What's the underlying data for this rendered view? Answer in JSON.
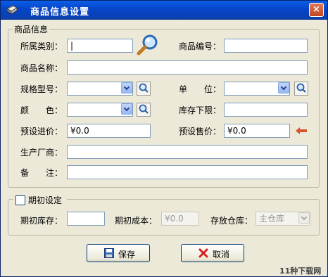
{
  "window": {
    "title": "商品信息设置",
    "close_symbol": "×",
    "icon": "app-book-icon"
  },
  "product_group": {
    "legend": "商品信息",
    "category_label": "所属类别：",
    "category_value": "|",
    "code_label": "商品编号：",
    "code_value": "",
    "name_label": "商品名称：",
    "name_value": "",
    "spec_label": "规格型号：",
    "spec_value": "",
    "unit_label": "单　　位：",
    "unit_value": "",
    "color_label": "颜　　色：",
    "color_value": "",
    "stock_min_label": "库存下限：",
    "stock_min_value": "",
    "preset_buy_label": "预设进价：",
    "preset_buy_value": "¥0.0",
    "preset_sell_label": "预设售价：",
    "preset_sell_value": "¥0.0",
    "manufacturer_label": "生产厂商：",
    "manufacturer_value": "",
    "remark_label": "备　　注：",
    "remark_value": ""
  },
  "opening_group": {
    "legend": "期初设定",
    "checked": false,
    "opening_stock_label": "期初库存：",
    "opening_stock_value": "",
    "opening_cost_label": "期初成本：",
    "opening_cost_value": "¥0.0",
    "warehouse_label": "存放仓库：",
    "warehouse_value": "主仓库"
  },
  "buttons": {
    "save_label": "保存",
    "cancel_label": "取消"
  },
  "watermark": "11种下载网",
  "colors": {
    "titlebar": "#0a5ee8",
    "dialog_bg": "#ece9d8",
    "field_border": "#7f9db9",
    "arrow": "#d9532b",
    "cancel_x": "#d42020"
  }
}
